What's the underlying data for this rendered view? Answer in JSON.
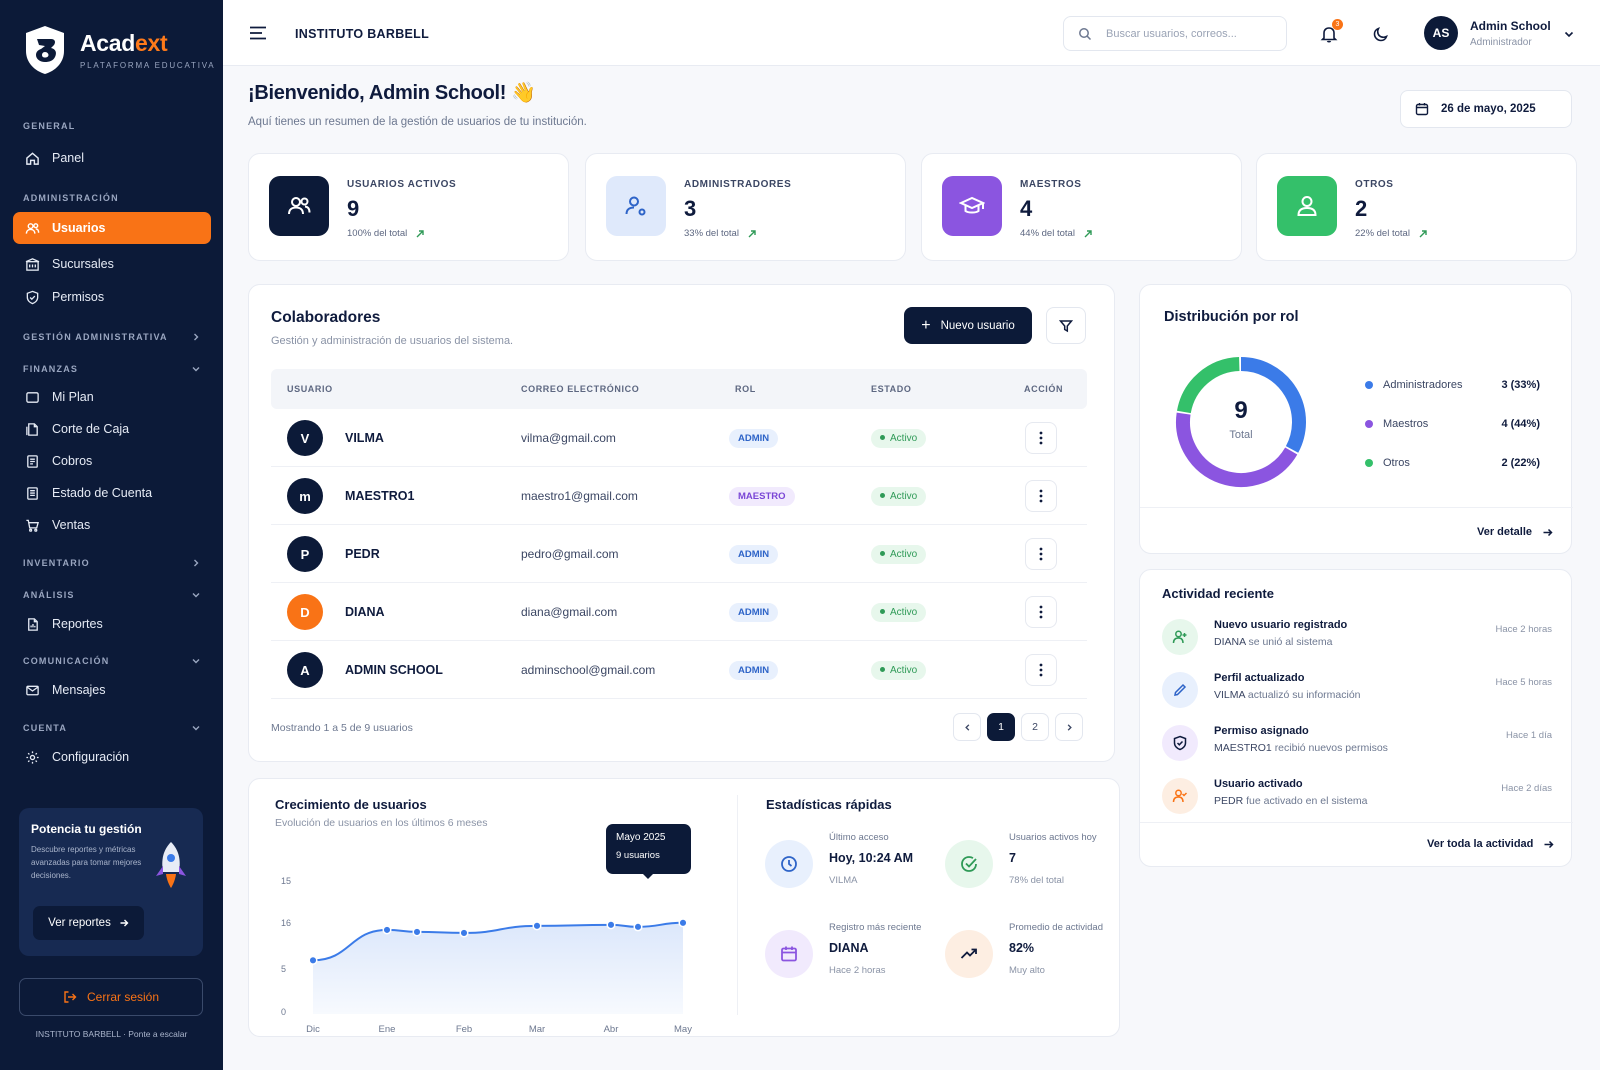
{
  "brand": {
    "name_a": "Acad",
    "name_b": "ext",
    "subtitle": "PLATAFORMA EDUCATIVA",
    "accent": "#f97316",
    "navy": "#0c1a38"
  },
  "sidebar": {
    "sections": {
      "general": "GENERAL",
      "admin": "ADMINISTRACIÓN",
      "gestion": "GESTIÓN ADMINISTRATIVA",
      "finanzas": "FINANZAS",
      "inventario": "INVENTARIO",
      "analisis": "ANÁLISIS",
      "comunicacion": "COMUNICACIÓN",
      "cuenta": "CUENTA"
    },
    "items": {
      "panel": "Panel",
      "usuarios": "Usuarios",
      "sucursales": "Sucursales",
      "permisos": "Permisos",
      "miplan": "Mi Plan",
      "corte": "Corte de Caja",
      "cobros": "Cobros",
      "estado": "Estado de Cuenta",
      "ventas": "Ventas",
      "reportes": "Reportes",
      "mensajes": "Mensajes",
      "config": "Configuración"
    },
    "promo": {
      "title": "Potencia tu gestión",
      "text": "Descubre reportes y métricas avanzadas para tomar mejores decisiones.",
      "button": "Ver reportes"
    },
    "logout": "Cerrar sesión",
    "footer": "INSTITUTO BARBELL · Ponte a escalar"
  },
  "topbar": {
    "institution": "INSTITUTO BARBELL",
    "search_placeholder": "Buscar usuarios, correos...",
    "notifications": "3",
    "avatar": "AS",
    "user_name": "Admin School",
    "user_role": "Administrador"
  },
  "welcome": {
    "title": "¡Bienvenido, Admin School! 👋",
    "subtitle": "Aquí tienes un resumen de la gestión de usuarios de tu institución.",
    "date": "26 de mayo, 2025"
  },
  "stats": [
    {
      "label": "USUARIOS ACTIVOS",
      "value": "9",
      "sub": "100% del total"
    },
    {
      "label": "ADMINISTRADORES",
      "value": "3",
      "sub": "33% del total"
    },
    {
      "label": "MAESTROS",
      "value": "4",
      "sub": "44% del total"
    },
    {
      "label": "OTROS",
      "value": "2",
      "sub": "22% del total"
    }
  ],
  "users_table": {
    "title": "Colaboradores",
    "subtitle": "Gestión y administración de usuarios del sistema.",
    "new_button": "Nuevo usuario",
    "columns": [
      "USUARIO",
      "CORREO ELECTRÓNICO",
      "ROL",
      "ESTADO",
      "ACCIÓN"
    ],
    "rows": [
      {
        "initial": "V",
        "name": "VILMA",
        "email": "vilma@gmail.com",
        "role": "ADMIN",
        "status": "Activo",
        "avatar_color": "#0c1a38"
      },
      {
        "initial": "m",
        "name": "MAESTRO1",
        "email": "maestro1@gmail.com",
        "role": "MAESTRO",
        "status": "Activo",
        "avatar_color": "#0c1a38"
      },
      {
        "initial": "P",
        "name": "PEDR",
        "email": "pedro@gmail.com",
        "role": "ADMIN",
        "status": "Activo",
        "avatar_color": "#0c1a38"
      },
      {
        "initial": "D",
        "name": "DIANA",
        "email": "diana@gmail.com",
        "role": "ADMIN",
        "status": "Activo",
        "avatar_color": "#f97316"
      },
      {
        "initial": "A",
        "name": "ADMIN SCHOOL",
        "email": "adminschool@gmail.com",
        "role": "ADMIN",
        "status": "Activo",
        "avatar_color": "#0c1a38"
      }
    ],
    "showing": "Mostrando 1 a 5 de 9 usuarios",
    "pages": [
      "1",
      "2"
    ],
    "current_page": "1"
  },
  "distribution": {
    "title": "Distribución por rol",
    "center_value": "9",
    "center_label": "Total",
    "link": "Ver detalle"
  },
  "activity": {
    "title": "Actividad reciente",
    "items": [
      {
        "title": "Nuevo usuario registrado",
        "who": "DIANA",
        "desc": "se unió al sistema",
        "time": "Hace 2 horas"
      },
      {
        "title": "Perfil actualizado",
        "who": "VILMA",
        "desc": "actualizó su información",
        "time": "Hace 5 horas"
      },
      {
        "title": "Permiso asignado",
        "who": "MAESTRO1",
        "desc": "recibió nuevos permisos",
        "time": "Hace 1 día"
      },
      {
        "title": "Usuario activado",
        "who": "PEDR",
        "desc": "fue activado en el sistema",
        "time": "Hace 2 días"
      }
    ],
    "link": "Ver toda la actividad"
  },
  "growth": {
    "title": "Crecimiento de usuarios",
    "subtitle": "Evolución de usuarios en los últimos 6 meses",
    "tooltip_title": "Mayo 2025",
    "tooltip_value": "9 usuarios"
  },
  "quick_stats": {
    "title": "Estadísticas rápidas",
    "items": [
      {
        "label": "Último acceso",
        "value": "Hoy, 10:24 AM",
        "sub": "VILMA"
      },
      {
        "label": "Usuarios activos hoy",
        "value": "7",
        "sub": "78% del total"
      },
      {
        "label": "Registro más reciente",
        "value": "DIANA",
        "sub": "Hace 2 horas"
      },
      {
        "label": "Promedio de actividad",
        "value": "82%",
        "sub": "Muy alto"
      }
    ]
  },
  "chart_data": [
    {
      "type": "pie",
      "title": "Distribución por rol",
      "categories": [
        "Administradores",
        "Maestros",
        "Otros"
      ],
      "values": [
        3,
        4,
        2
      ],
      "labels": [
        "3 (33%)",
        "4 (44%)",
        "2 (22%)"
      ],
      "colors": [
        "#3b7be8",
        "#8b55e0",
        "#34c06a"
      ],
      "legend": "right"
    },
    {
      "type": "area",
      "title": "Crecimiento de usuarios",
      "x": [
        "Dic",
        "Ene",
        "Feb",
        "Mar",
        "Abr",
        "May"
      ],
      "y_tick_labels": [
        "0",
        "5",
        "16",
        "15"
      ],
      "ylim": [
        0,
        15
      ],
      "series": [
        {
          "x": [
            "Dic",
            "Ene",
            "Ene-Feb",
            "Feb",
            "Mar",
            "Abr",
            "Abr-May",
            "May"
          ],
          "values": [
            5.3,
            8.3,
            8.1,
            8.0,
            8.7,
            8.8,
            8.6,
            9.0
          ]
        }
      ],
      "color": "#3b7be8",
      "grid": false
    }
  ]
}
